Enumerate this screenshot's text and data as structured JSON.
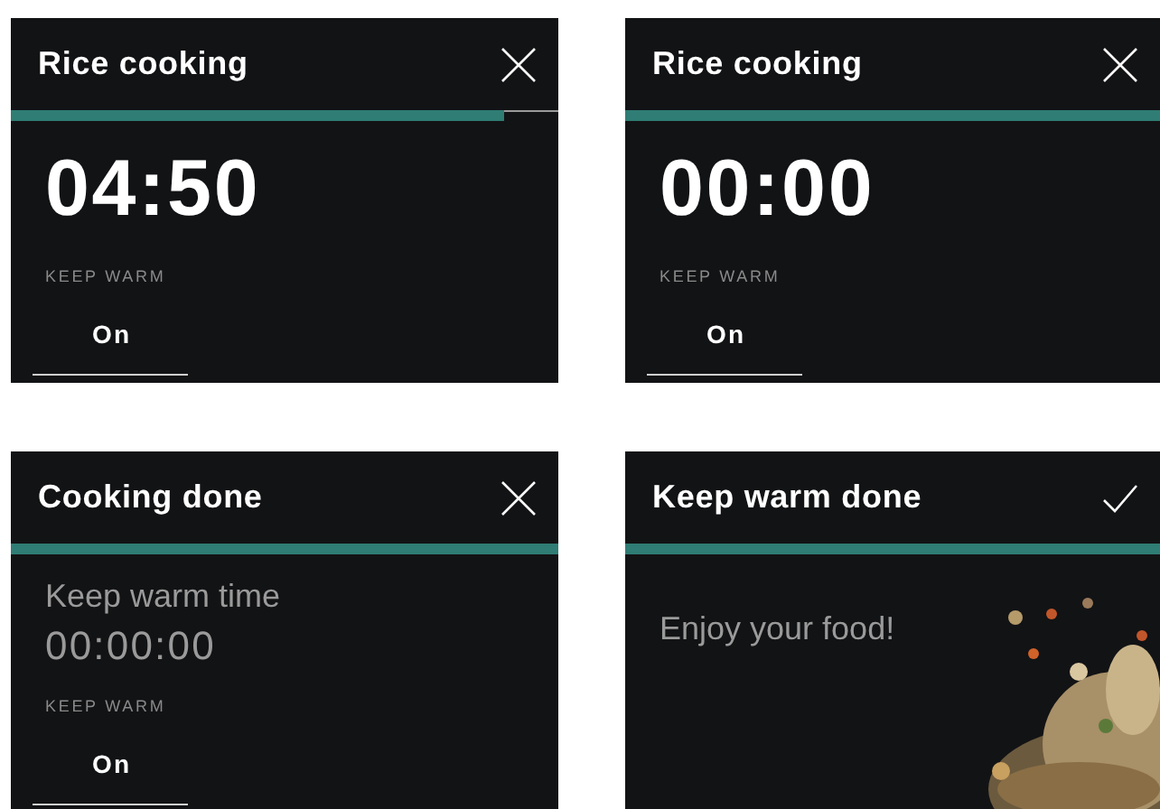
{
  "panels": [
    {
      "title": "Rice cooking",
      "action": {
        "kind": "close"
      },
      "progress": {
        "level": 0.9
      },
      "body": {
        "kind": "timer",
        "time": "04:50",
        "setting_label": "KEEP WARM",
        "setting_value": "On"
      }
    },
    {
      "title": "Rice cooking",
      "action": {
        "kind": "close"
      },
      "progress": {
        "level": 1
      },
      "body": {
        "kind": "timer",
        "time": "00:00",
        "setting_label": "KEEP WARM",
        "setting_value": "On"
      }
    },
    {
      "title": "Cooking done",
      "action": {
        "kind": "close"
      },
      "progress": {
        "level": 1
      },
      "body": {
        "kind": "keep_warm",
        "label": "Keep warm time",
        "time": "00:00:00",
        "setting_label": "KEEP WARM",
        "setting_value": "On"
      }
    },
    {
      "title": "Keep warm done",
      "action": {
        "kind": "check"
      },
      "progress": {
        "level": 1
      },
      "body": {
        "kind": "message",
        "text": "Enjoy your food!"
      }
    }
  ]
}
